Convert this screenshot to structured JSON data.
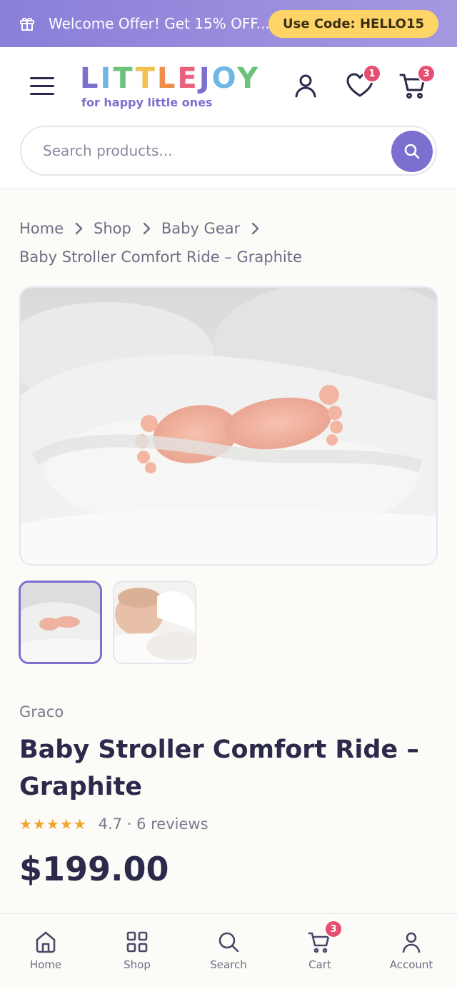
{
  "promo": {
    "message": "Welcome Offer! Get 15% OFF...",
    "code_label": "Use Code: HELLO15",
    "icon": "gift-icon"
  },
  "header": {
    "logo_text": "LITTLEJOY",
    "logo_letters": [
      {
        "ch": "L",
        "color": "#7b6fd0"
      },
      {
        "ch": "I",
        "color": "#6fb6e6"
      },
      {
        "ch": "T",
        "color": "#6cc27a"
      },
      {
        "ch": "T",
        "color": "#f2c14e"
      },
      {
        "ch": "L",
        "color": "#ee8e4a"
      },
      {
        "ch": "E",
        "color": "#e8607c"
      },
      {
        "ch": "J",
        "color": "#7b6fd0"
      },
      {
        "ch": "O",
        "color": "#6fb6e6"
      },
      {
        "ch": "Y",
        "color": "#6cc27a"
      }
    ],
    "tagline": "for happy little ones",
    "wishlist_count": "1",
    "cart_count": "3",
    "icons": [
      "menu-icon",
      "user-icon",
      "heart-icon",
      "cart-icon"
    ]
  },
  "search": {
    "placeholder": "Search products...",
    "value": "",
    "icon": "search-icon"
  },
  "breadcrumb": {
    "items": [
      "Home",
      "Shop",
      "Baby Gear"
    ],
    "current": "Baby Stroller Comfort Ride – Graphite"
  },
  "product": {
    "brand": "Graco",
    "title": "Baby Stroller Comfort Ride – Graphite",
    "stars": "★★★★★",
    "rating_text": "4.7 · 6 reviews",
    "rating": 4.7,
    "price": "$199.00",
    "images": [
      "baby feet in white blanket",
      "sleeping baby"
    ],
    "active_image": 0
  },
  "tabbar": {
    "items": [
      {
        "label": "Home",
        "icon": "home-icon"
      },
      {
        "label": "Shop",
        "icon": "grid-icon"
      },
      {
        "label": "Search",
        "icon": "search-icon"
      },
      {
        "label": "Cart",
        "icon": "cart-icon"
      },
      {
        "label": "Account",
        "icon": "user-icon"
      }
    ],
    "cart_count": "3"
  },
  "colors": {
    "accent": "#7b6fd0",
    "badge": "#e84d72",
    "code_bg": "#ffd466",
    "star": "#f0a52a",
    "text": "#2b2a4a"
  }
}
